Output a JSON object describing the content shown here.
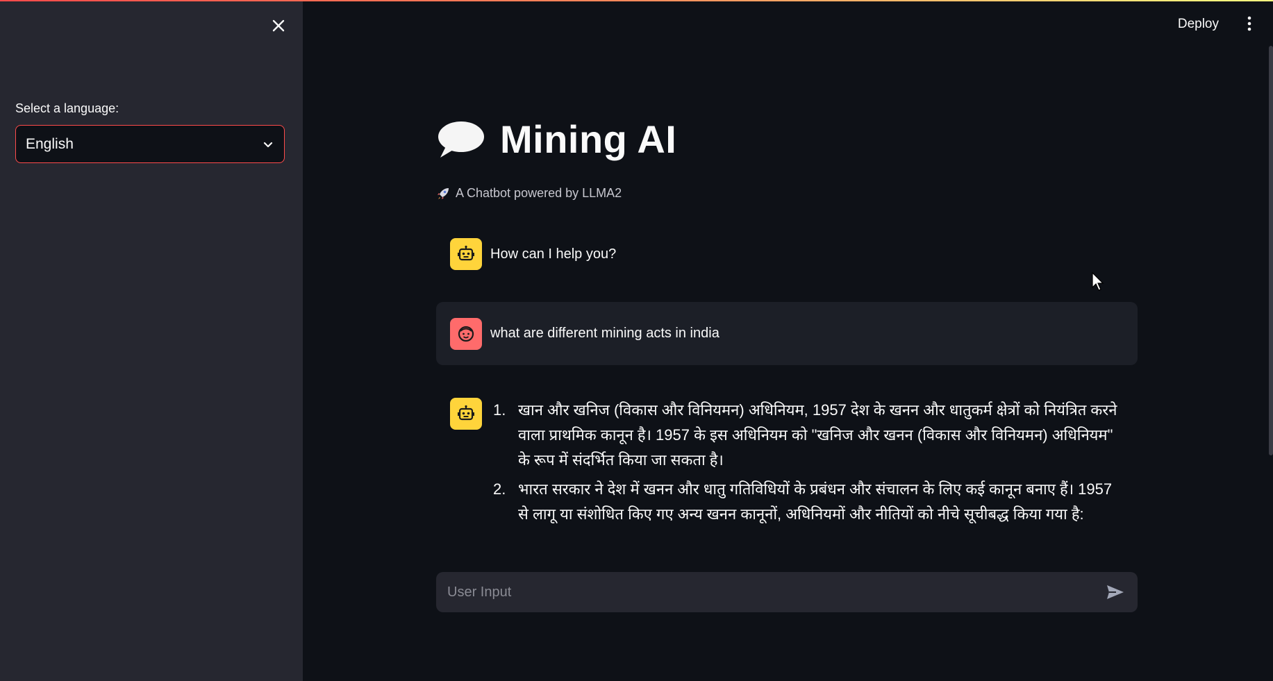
{
  "sidebar": {
    "language_label": "Select a language:",
    "language_selected": "English"
  },
  "header": {
    "deploy_label": "Deploy"
  },
  "main": {
    "title": "Mining AI",
    "subtitle": "A Chatbot powered by LLMA2"
  },
  "messages": [
    {
      "role": "assistant",
      "text": "How can I help you?"
    },
    {
      "role": "user",
      "text": "what are different mining acts in india"
    }
  ],
  "answer": {
    "items": [
      {
        "num": "1.",
        "text": "खान और खनिज (विकास और विनियमन) अधिनियम, 1957 देश के खनन और धातुकर्म क्षेत्रों को नियंत्रित करने वाला प्राथमिक कानून है। 1957 के इस अधिनियम को \"खनिज और खनन (विकास और विनियमन) अधिनियम\" के रूप में संदर्भित किया जा सकता है।"
      },
      {
        "num": "2.",
        "text": "भारत सरकार ने देश में खनन और धातु गतिविधियों के प्रबंधन और संचालन के लिए कई कानून बनाए हैं। 1957 से लागू या संशोधित किए गए अन्य खनन कानूनों, अधिनियमों और नीतियों को नीचे सूचीबद्ध किया गया है:"
      }
    ]
  },
  "input": {
    "placeholder": "User Input"
  },
  "colors": {
    "background": "#0e1117",
    "sidebar": "#262730",
    "accent": "#ff4b4b",
    "bot_avatar": "#ffd43b",
    "user_avatar": "#ff6b6b"
  },
  "icons": {
    "close": "close-icon",
    "chevron": "chevron-down-icon",
    "menu": "kebab-menu-icon",
    "title": "speech-bubble-icon",
    "subtitle": "rocket-icon",
    "bot": "robot-icon",
    "user": "face-icon",
    "send": "send-icon"
  }
}
